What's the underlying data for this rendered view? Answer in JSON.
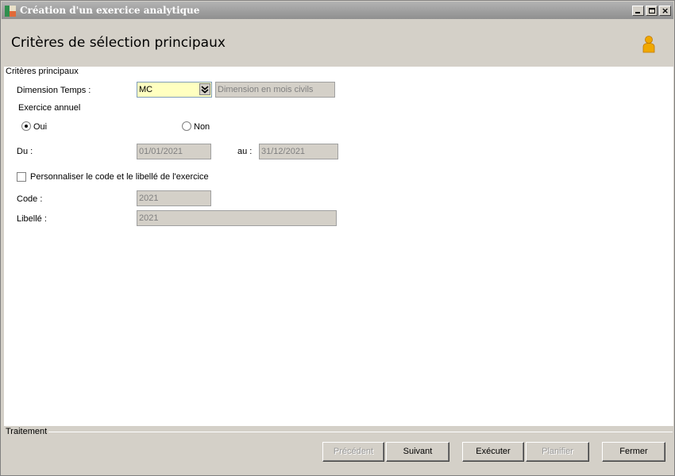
{
  "window": {
    "title": "Création d'un exercice analytique",
    "controls": {
      "minimize": "minimize",
      "maximize": "maximize",
      "close": "×"
    }
  },
  "header": {
    "title": "Critères de sélection principaux",
    "icon": "person-icon"
  },
  "main": {
    "group_title": "Critères principaux",
    "dimension": {
      "label": "Dimension Temps :",
      "value": "MC",
      "description": "Dimension en mois civils"
    },
    "exercice_annuel": {
      "label": "Exercice annuel",
      "options": [
        {
          "label": "Oui",
          "selected": true
        },
        {
          "label": "Non",
          "selected": false
        }
      ]
    },
    "du": {
      "label": "Du :",
      "value": "01/01/2021"
    },
    "au": {
      "label": "au :",
      "value": "31/12/2021"
    },
    "personnaliser": {
      "label": "Personnaliser le code et le libellé de l'exercice",
      "checked": false
    },
    "code": {
      "label": "Code :",
      "value": "2021"
    },
    "libelle": {
      "label": "Libellé  :",
      "value": "2021"
    }
  },
  "footer": {
    "group_title": "Traitement",
    "buttons": {
      "precedent": "Précédent",
      "suivant": "Suivant",
      "executer": "Exécuter",
      "planifier": "Planifier",
      "fermer": "Fermer"
    }
  },
  "colors": {
    "titlebar": "#9a9a9a",
    "window_bg": "#d4d0c8",
    "active_field": "#ffffc0",
    "person_icon": "#f0a800"
  }
}
